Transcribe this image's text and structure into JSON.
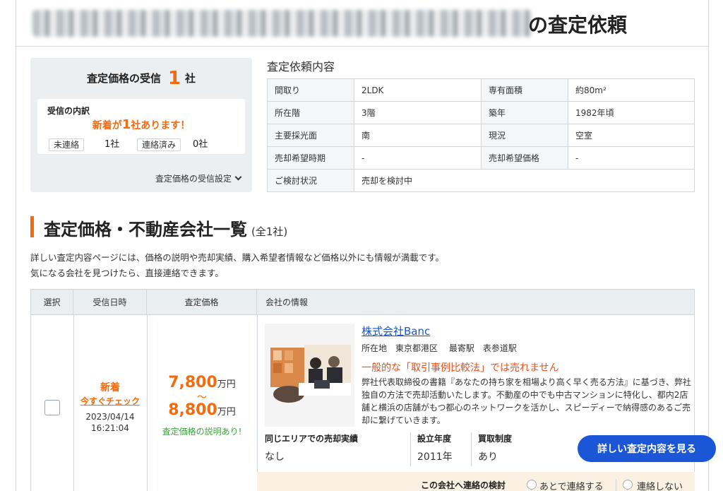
{
  "header": {
    "title": "の査定依頼"
  },
  "summary": {
    "title_prefix": "査定価格の受信",
    "count": "1",
    "unit": "社",
    "breakdown_title": "受信の内訳",
    "new_prefix": "新着が",
    "new_count": "1",
    "new_suffix": "社あります！",
    "uncontacted_label": "未連絡",
    "uncontacted_value": "1社",
    "contacted_label": "連絡済み",
    "contacted_value": "0社",
    "setting_link": "査定価格の受信設定"
  },
  "request": {
    "heading": "査定依頼内容",
    "rows": [
      {
        "k1": "間取り",
        "v1": "2LDK",
        "k2": "専有面積",
        "v2": "約80m²"
      },
      {
        "k1": "所在階",
        "v1": "3階",
        "k2": "築年",
        "v2": "1982年頃"
      },
      {
        "k1": "主要採光面",
        "v1": "南",
        "k2": "現況",
        "v2": "空室"
      },
      {
        "k1": "売却希望時期",
        "v1": "-",
        "k2": "売却希望価格",
        "v2": "-"
      },
      {
        "k1": "ご検討状況",
        "v1": "売却を検討中"
      }
    ]
  },
  "section": {
    "title": "査定価格・不動産会社一覧",
    "sub": "(全1社)",
    "desc1": "詳しい査定内容ページには、価格の説明や売却実績、購入希望者情報など価格以外にも情報が満載です。",
    "desc2": "気になる会社を見つけたら、直接連絡できます。"
  },
  "list": {
    "headers": [
      "選択",
      "受信日時",
      "査定価格",
      "会社の情報"
    ],
    "row": {
      "new_label": "新着",
      "check_link": "今すぐチェック",
      "date": "2023/04/14",
      "time": "16:21:04",
      "price_low": "7,800",
      "price_high": "8,800",
      "price_unit": "万円",
      "tilde": "〜",
      "price_note": "査定価格の説明あり!",
      "company_name": "株式会社Banc",
      "location": "所在地　東京都港区　 最寄駅　表参道駅",
      "catch": "一般的な「取引事例比較法」では売れません",
      "text": "弊社代表取締役の書籍『あなたの持ち家を相場より高く早く売る方法』に基づき、弊社独自の方法で売却活動いたします。不動産の中でも中古マンションに特化し、都内2店舗と横浜の店舗がもつ都心のネットワークを活かし、スピーディーで納得感のあるご売却に繋げていきます。",
      "stat1_label": "同じエリアでの売却実績",
      "stat1_value": "なし",
      "stat2_label": "設立年度",
      "stat2_value": "2011年",
      "stat3_label": "買取制度",
      "stat3_value": "あり",
      "detail_button": "詳しい査定内容を見る",
      "contact_label": "この会社へ連絡の検討",
      "option_later": "あとで連絡する",
      "option_no": "連絡しない"
    }
  }
}
